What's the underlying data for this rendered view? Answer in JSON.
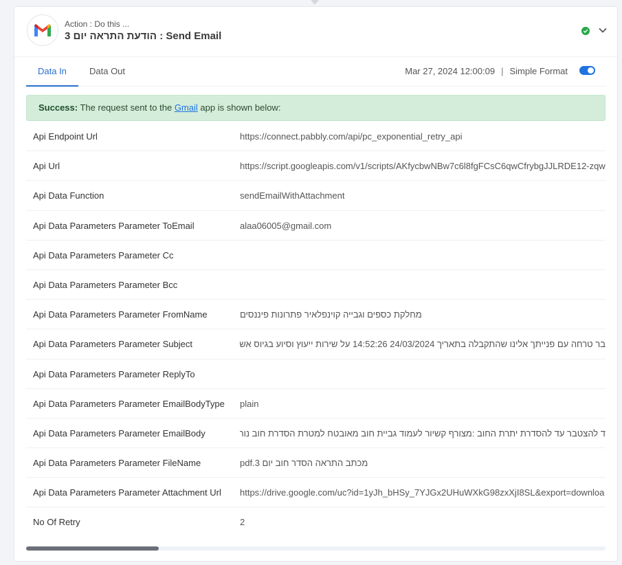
{
  "header": {
    "action_sub": "Action : Do this ...",
    "action_title": "3 הודעת התראה יום : Send Email",
    "logo_icon": "gmail-logo-icon",
    "status_icon": "check-circle-icon",
    "status_color": "#2aa84a",
    "chevron_icon": "chevron-down-icon"
  },
  "tabs": [
    {
      "label": "Data In",
      "active": true
    },
    {
      "label": "Data Out",
      "active": false
    }
  ],
  "meta": {
    "timestamp": "Mar 27, 2024 12:00:09",
    "separator": "|",
    "simple_format_label": "Simple Format",
    "simple_format_on": true
  },
  "alert": {
    "strong": "Success:",
    "text_before": "The request sent to the",
    "link": "Gmail",
    "text_after": "app is shown below:"
  },
  "rows": [
    {
      "key": "Api Endpoint Url",
      "value": "https://connect.pabbly.com/api/pc_exponential_retry_api"
    },
    {
      "key": "Api Url",
      "value": "https://script.googleapis.com/v1/scripts/AKfycbwNBw7c6l8fgFCsC6qwCfrybgJJLRDE12-zqw"
    },
    {
      "key": "Api Data Function",
      "value": "sendEmailWithAttachment"
    },
    {
      "key": "Api Data Parameters Parameter ToEmail",
      "value": "alaa06005@gmail.com"
    },
    {
      "key": "Api Data Parameters Parameter Cc",
      "value": ""
    },
    {
      "key": "Api Data Parameters Parameter Bcc",
      "value": ""
    },
    {
      "key": "Api Data Parameters Parameter FromName",
      "value": "מחלקת כספים וגבייה קוינפלאיר פתרונות פיננסים"
    },
    {
      "key": "Api Data Parameters Parameter Subject",
      "value": "בר טרחה עם פנייתך אלינו שהתקבלה בתאריך 24/03/2024 14:52:26 על שירות ייעוץ וסיוע בגיוס אשראי עסקי"
    },
    {
      "key": "Api Data Parameters Parameter ReplyTo",
      "value": ""
    },
    {
      "key": "Api Data Parameters Parameter EmailBodyType",
      "value": "plain"
    },
    {
      "key": "Api Data Parameters Parameter EmailBody",
      "value": "ד להצטבר עד להסדרת יתרת החוב :מצורף קשיור לעמוד גביית חוב מאובטח למטרת הסדרת חוב נוחה ללקוחותנו,"
    },
    {
      "key": "Api Data Parameters Parameter FileName",
      "value": "מכתב התראה הסדר חוב יום 3.pdf"
    },
    {
      "key": "Api Data Parameters Parameter Attachment Url",
      "value": "https://drive.google.com/uc?id=1yJh_bHSy_7YJGx2UHuWXkG98zxXjI8SL&export=downloa"
    },
    {
      "key": "No Of Retry",
      "value": "2"
    }
  ],
  "scrollbar": {
    "position": 0.0
  }
}
